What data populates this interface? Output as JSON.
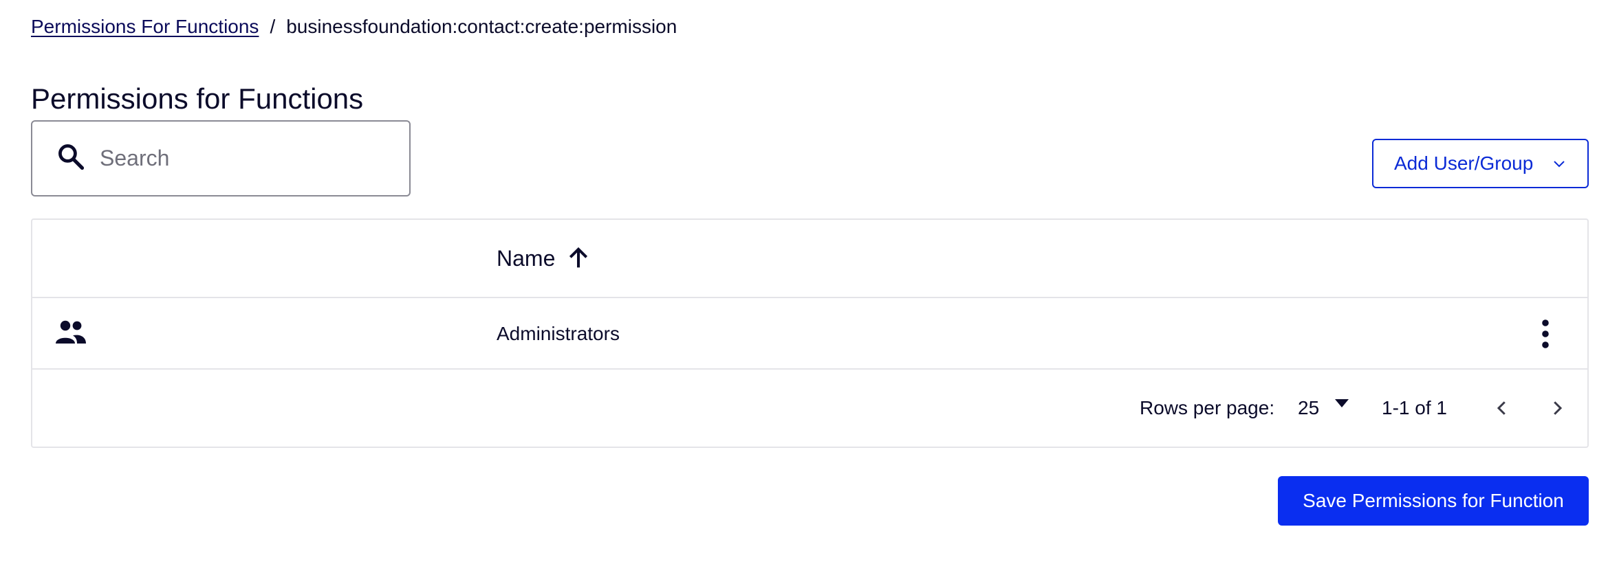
{
  "breadcrumb": {
    "parent": "Permissions For Functions",
    "separator": "/",
    "current": "businessfoundation:contact:create:permission"
  },
  "page_title": "Permissions for Functions",
  "search": {
    "placeholder": "Search",
    "value": ""
  },
  "add_button": {
    "label": "Add User/Group"
  },
  "table": {
    "columns": [
      {
        "label": "Name",
        "sort": "ascending"
      }
    ],
    "rows": [
      {
        "icon": "group-icon",
        "name": "Administrators"
      }
    ]
  },
  "pagination": {
    "rows_per_page_label": "Rows per page:",
    "rows_per_page": "25",
    "range": "1-1 of 1"
  },
  "save_button": {
    "label": "Save Permissions for Function"
  },
  "colors": {
    "primary": "#0a2ef0",
    "outline": "#0a2ad6",
    "text": "#0b0b2a",
    "border": "#e4e4e8"
  }
}
